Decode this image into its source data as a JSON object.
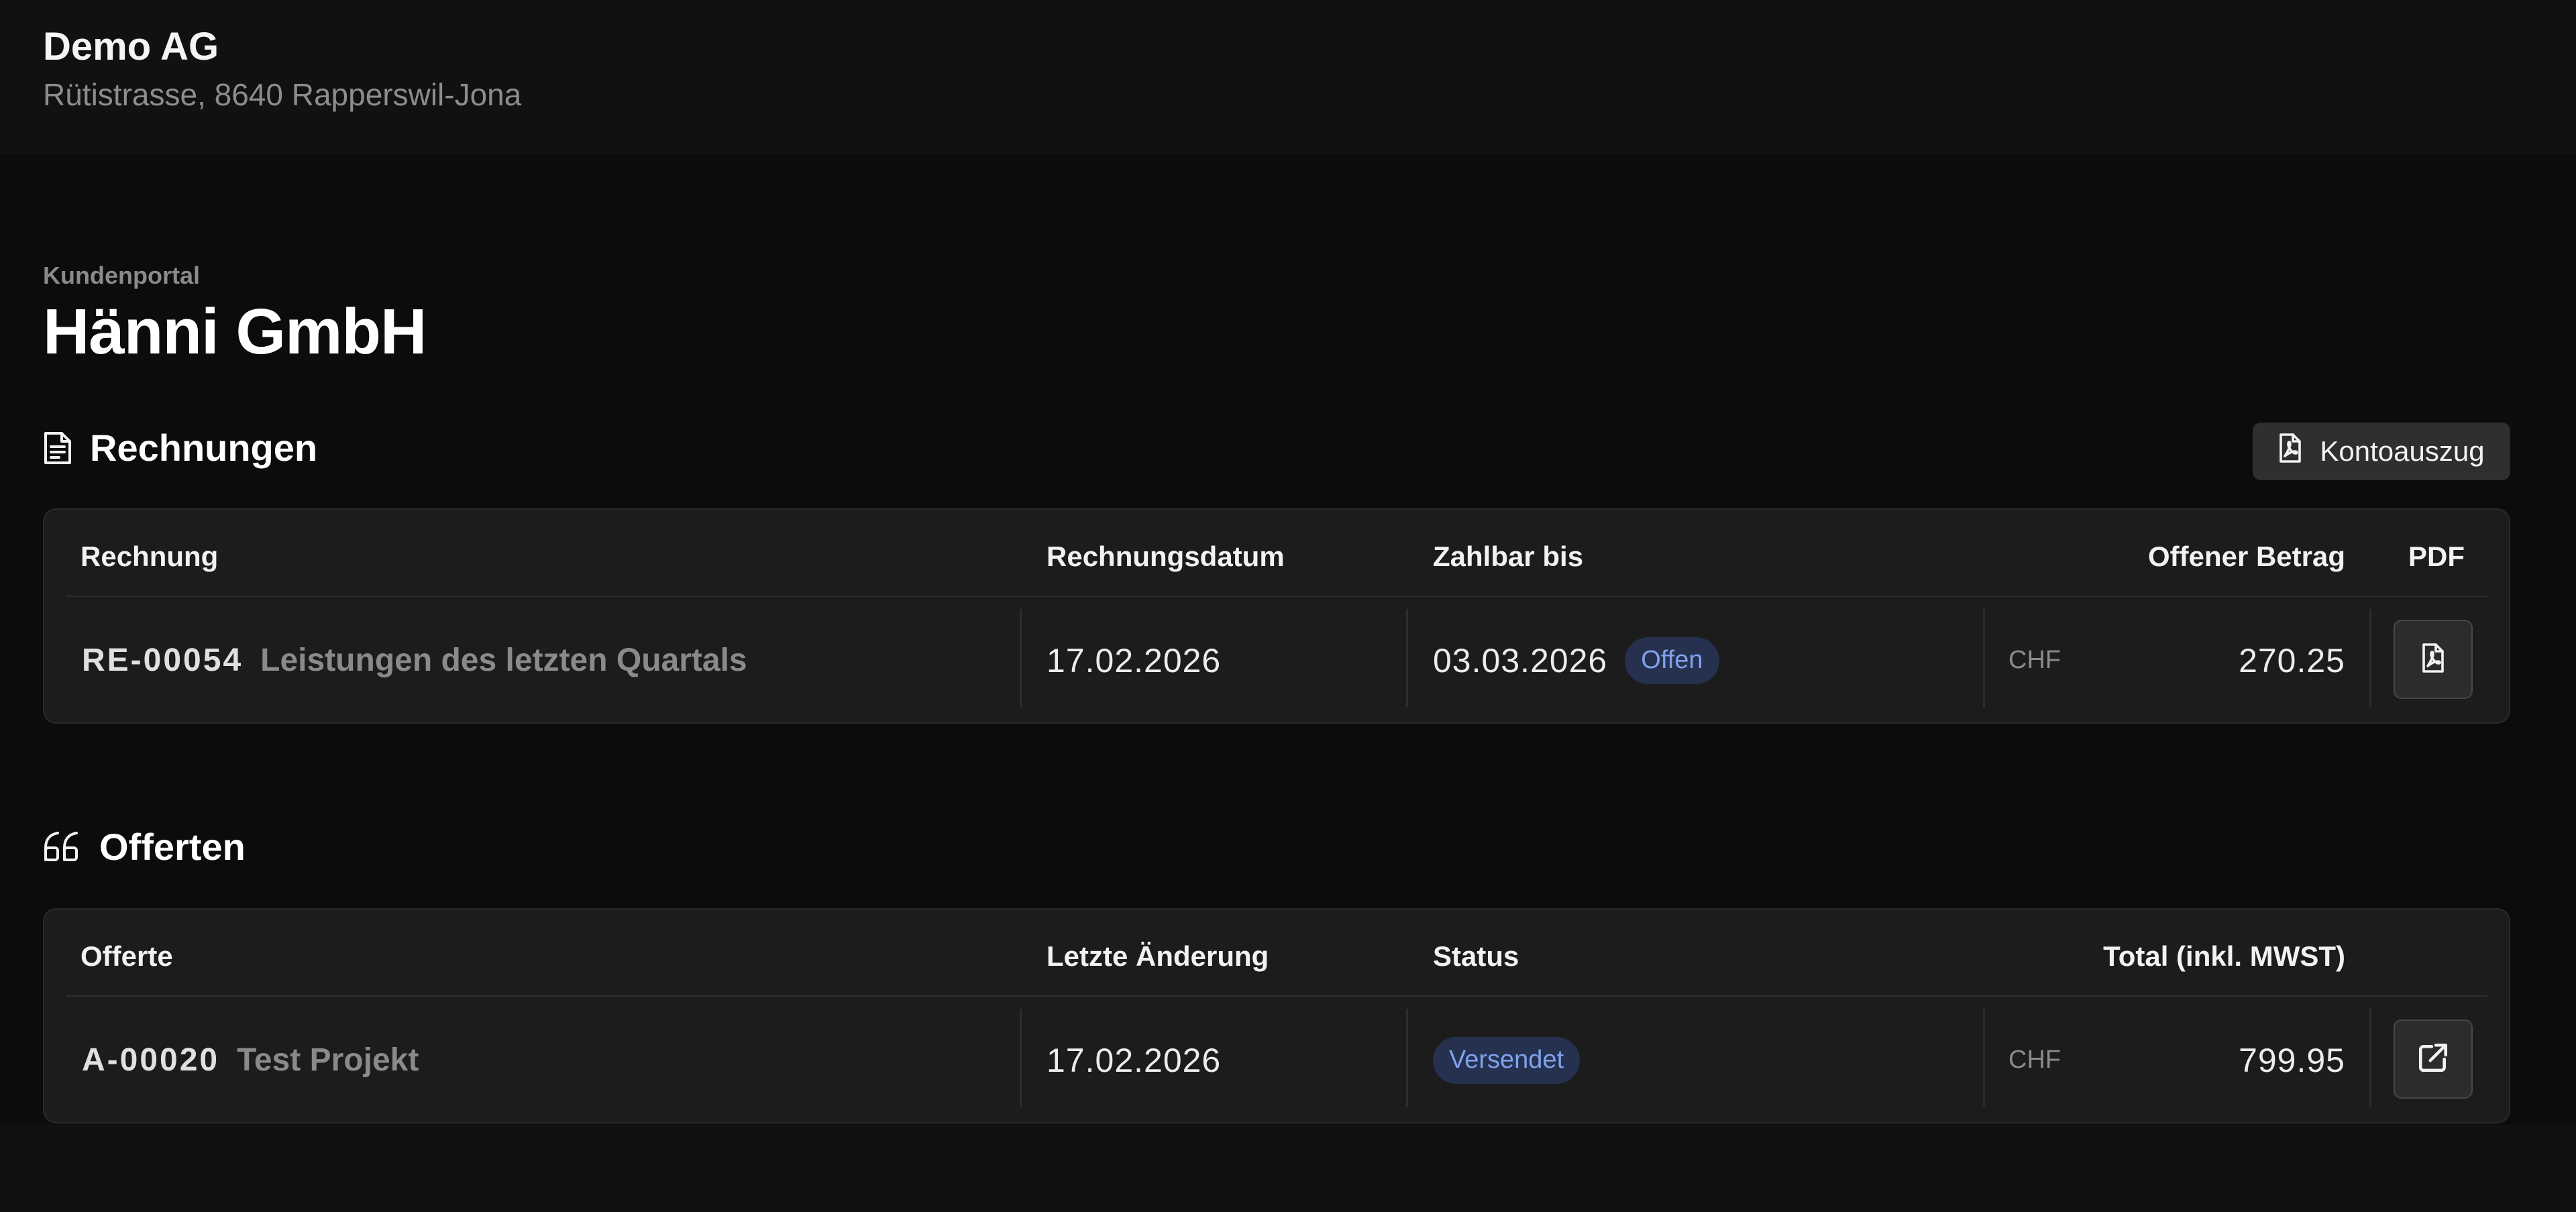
{
  "company": {
    "name": "Demo AG",
    "address": "Rütistrasse, 8640 Rapperswil-Jona"
  },
  "portal": {
    "eyebrow": "Kundenportal",
    "customer_name": "Hänni GmbH"
  },
  "invoices": {
    "title": "Rechnungen",
    "title_icon": "document-icon",
    "statement_button": {
      "label": "Kontoauszug",
      "icon": "pdf-file-icon"
    },
    "columns": {
      "invoice": "Rechnung",
      "invoice_date": "Rechnungsdatum",
      "due_date": "Zahlbar bis",
      "open_amount": "Offener Betrag",
      "pdf": "PDF"
    },
    "rows": [
      {
        "number": "RE-00054",
        "description": "Leistungen des letzten Quartals",
        "invoice_date": "17.02.2026",
        "due_date": "03.03.2026",
        "status": "Offen",
        "currency": "CHF",
        "amount": "270.25",
        "action_icon": "pdf-file-icon"
      }
    ]
  },
  "offers": {
    "title": "Offerten",
    "title_icon": "quote-icon",
    "columns": {
      "offer": "Offerte",
      "last_change": "Letzte Änderung",
      "status": "Status",
      "total": "Total (inkl. MWST)"
    },
    "rows": [
      {
        "number": "A-00020",
        "description": "Test Projekt",
        "last_change": "17.02.2026",
        "status": "Versendet",
        "currency": "CHF",
        "amount": "799.95",
        "action_icon": "external-link-icon"
      }
    ]
  },
  "colors": {
    "background": "#0c0c0c",
    "header_background": "#111111",
    "card_background": "#1c1c1c",
    "badge_background": "#25314f",
    "badge_text": "#7fa2ec",
    "muted_text": "#8a8a8a"
  }
}
